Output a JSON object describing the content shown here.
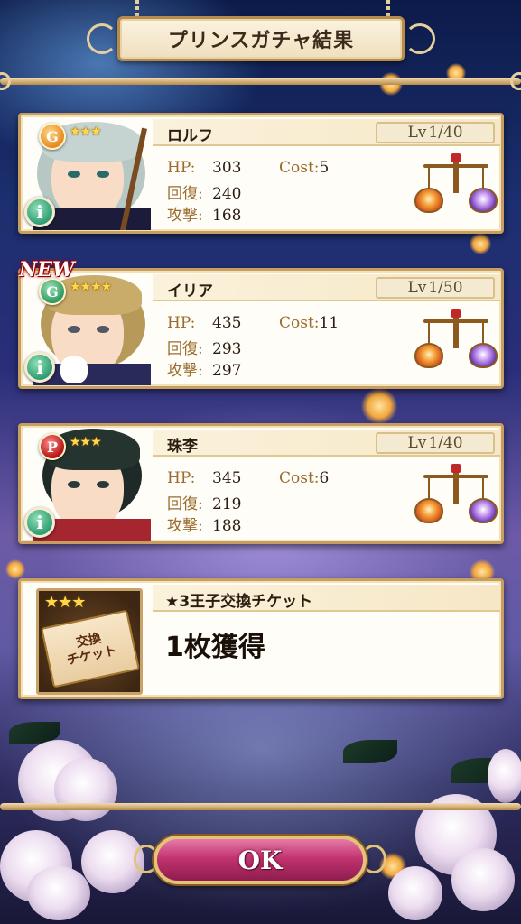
{
  "title": "プリンスガチャ結果",
  "cards": [
    {
      "name": "ロルフ",
      "rarity": "G",
      "rarity_color": "#f2a53a",
      "stars": "★★★",
      "is_new": false,
      "level_label": "Lv",
      "level": "1/40",
      "hp_label": "HP:",
      "hp": "303",
      "recover_label": "回復:",
      "recover": "240",
      "attack_label": "攻撃:",
      "attack": "168",
      "cost_label": "Cost:",
      "cost": "5"
    },
    {
      "name": "イリア",
      "rarity": "G",
      "rarity_color": "#3aa56c",
      "stars": "★★★★",
      "is_new": true,
      "new_label": "NEW",
      "level_label": "Lv",
      "level": "1/50",
      "hp_label": "HP:",
      "hp": "435",
      "recover_label": "回復:",
      "recover": "293",
      "attack_label": "攻撃:",
      "attack": "297",
      "cost_label": "Cost:",
      "cost": "11"
    },
    {
      "name": "珠李",
      "rarity": "P",
      "rarity_color": "#c92a2a",
      "stars": "★★★",
      "is_new": false,
      "level_label": "Lv",
      "level": "1/40",
      "hp_label": "HP:",
      "hp": "345",
      "recover_label": "回復:",
      "recover": "219",
      "attack_label": "攻撃:",
      "attack": "188",
      "cost_label": "Cost:",
      "cost": "6"
    }
  ],
  "info_glyph": "i",
  "ticket": {
    "stars": "★★★",
    "icon_line1": "交換",
    "icon_line2": "チケット",
    "name": "★3王子交換チケット",
    "count": "1枚獲得"
  },
  "ok_label": "OK",
  "icons": {
    "rarity": "rarity-badge-icon",
    "info": "info-icon",
    "scale": "balance-scale-icon",
    "ticket": "exchange-ticket-icon"
  }
}
